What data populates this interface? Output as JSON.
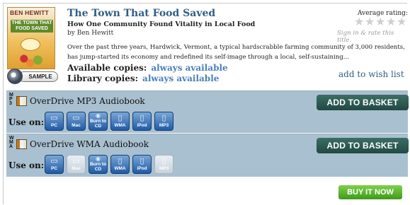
{
  "book": {
    "cover": {
      "author": "BEN HEWITT",
      "title": "THE TOWN THAT FOOD SAVED"
    },
    "title": "The Town That Food Saved",
    "subtitle": "How One Community Found Vitality in Local Food",
    "byline": "by Ben Hewitt",
    "description": "Over the past three years, Hardwick, Vermont, a typical hardscrabble farming community of 3,000 residents, has jump-started its economy and redefined its self-image through a local, self-sustaining...",
    "sample_label": "SAMPLE"
  },
  "rating": {
    "label": "Average rating:",
    "value": 0,
    "max": 5,
    "sign_in_text": "Sign in & rate this title."
  },
  "availability": {
    "available_label": "Available copies:",
    "available_value": "always available",
    "library_label": "Library copies:",
    "library_value": "always available"
  },
  "wishlist_label": "add to wish list",
  "formats": [
    {
      "letters": "MP3",
      "name": "OverDrive MP3 Audiobook",
      "basket_label": "ADD TO BASKET",
      "use_on_label": "Use on:",
      "devices": [
        {
          "icon": "pc-icon",
          "label": "PC",
          "enabled": true
        },
        {
          "icon": "mac-icon",
          "label": "Mac",
          "enabled": true
        },
        {
          "icon": "burn-cd-icon",
          "label": "Burn to CD",
          "enabled": true
        },
        {
          "icon": "wma-icon",
          "label": "WMA",
          "enabled": true
        },
        {
          "icon": "ipod-icon",
          "label": "iPod",
          "enabled": true
        },
        {
          "icon": "mp3-player-icon",
          "label": "MP3",
          "enabled": true
        }
      ]
    },
    {
      "letters": "WMA",
      "name": "OverDrive WMA Audiobook",
      "basket_label": "ADD TO BASKET",
      "use_on_label": "Use on:",
      "devices": [
        {
          "icon": "pc-icon",
          "label": "PC",
          "enabled": true
        },
        {
          "icon": "mac-icon",
          "label": "Mac",
          "enabled": false
        },
        {
          "icon": "burn-cd-icon",
          "label": "Burn to CD",
          "enabled": true
        },
        {
          "icon": "wma-icon",
          "label": "WMA",
          "enabled": true
        },
        {
          "icon": "ipod-icon",
          "label": "iPod",
          "enabled": true
        },
        {
          "icon": "mp3-player-icon",
          "label": "MP3",
          "enabled": false
        }
      ]
    }
  ],
  "buy_now_label": "BUY IT NOW",
  "colors": {
    "title_blue": "#2f5f86",
    "link_blue": "#4a7fb9",
    "panel_bg": "#a9c0d0",
    "basket_green": "#214942",
    "buy_green": "#3f9a1a"
  }
}
